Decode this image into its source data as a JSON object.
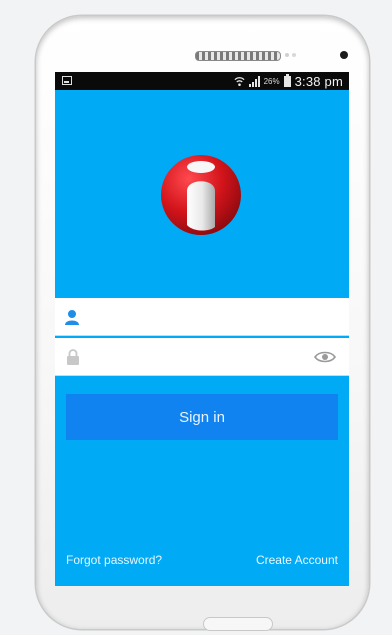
{
  "status_bar": {
    "battery_percent": "26%",
    "time": "3:38 pm",
    "icons": [
      "app-notification-icon",
      "wifi-icon",
      "signal-icon",
      "battery-icon"
    ]
  },
  "login": {
    "logo_icon": "red-sphere-logo-icon",
    "username": {
      "value": "",
      "icon": "user-icon"
    },
    "password": {
      "value": "",
      "icon": "lock-icon",
      "toggle_icon": "eye-icon"
    },
    "sign_in_label": "Sign in",
    "forgot_password_label": "Forgot password?",
    "create_account_label": "Create Account"
  },
  "colors": {
    "screen_background": "#00aaf5",
    "button_background": "#1183f0",
    "logo_red": "#d3141b"
  }
}
